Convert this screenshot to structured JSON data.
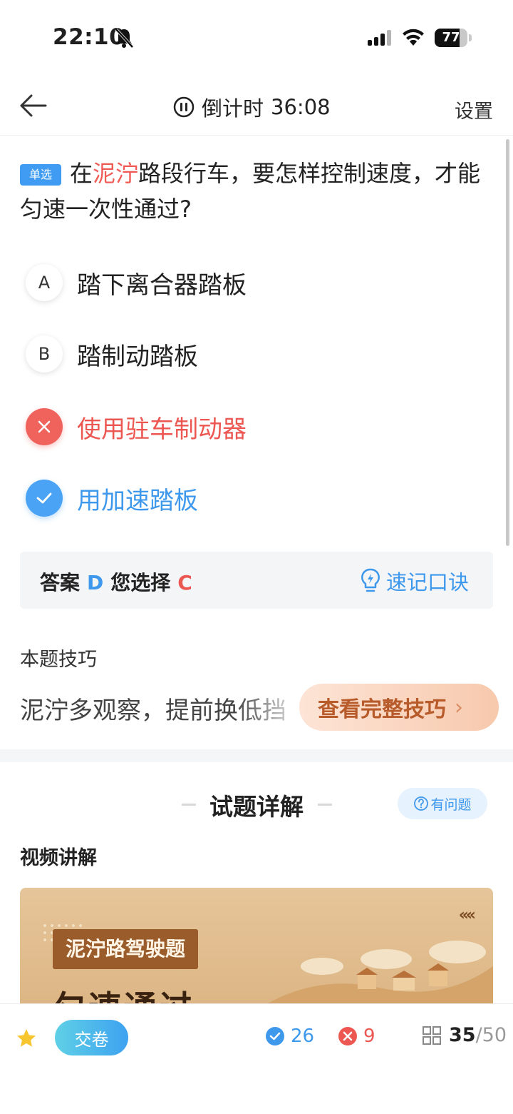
{
  "status_bar": {
    "time": "22:10",
    "battery": "77",
    "battery_level": 0.77
  },
  "nav": {
    "timer_label": "倒计时",
    "timer_value": "36:08",
    "settings": "设置"
  },
  "question": {
    "type_tag": "单选",
    "text_before": "在",
    "text_highlight": "泥泞",
    "text_after": "路段行车，要怎样控制速度，才能匀速一次性通过?"
  },
  "options": [
    {
      "letter": "A",
      "text": "踏下离合器踏板",
      "state": "normal"
    },
    {
      "letter": "B",
      "text": "踏制动踏板",
      "state": "normal"
    },
    {
      "letter": "C",
      "text": "使用驻车制动器",
      "state": "wrong"
    },
    {
      "letter": "D",
      "text": "用加速踏板",
      "state": "correct"
    }
  ],
  "answer": {
    "label": "答案",
    "correct": "D",
    "chosen_label": "您选择",
    "chosen": "C",
    "mnemonic": "速记口诀"
  },
  "tip": {
    "title": "本题技巧",
    "text": "泥泞多观察，提前换低挡",
    "button": "查看完整技巧",
    "arrow": "›"
  },
  "detail": {
    "title": "试题详解",
    "question_button": "有问题",
    "video_label": "视频讲解"
  },
  "video": {
    "tag": "泥泞路驾驶题",
    "headline": "匀速通过",
    "arrows": "‹‹‹‹"
  },
  "bottom": {
    "submit": "交卷",
    "correct_count": "26",
    "wrong_count": "9",
    "current": "35",
    "total": "/50"
  },
  "colors": {
    "accent_blue": "#3e98ec",
    "wrong_red": "#ec5752",
    "tip_brown": "#b85b2b"
  }
}
